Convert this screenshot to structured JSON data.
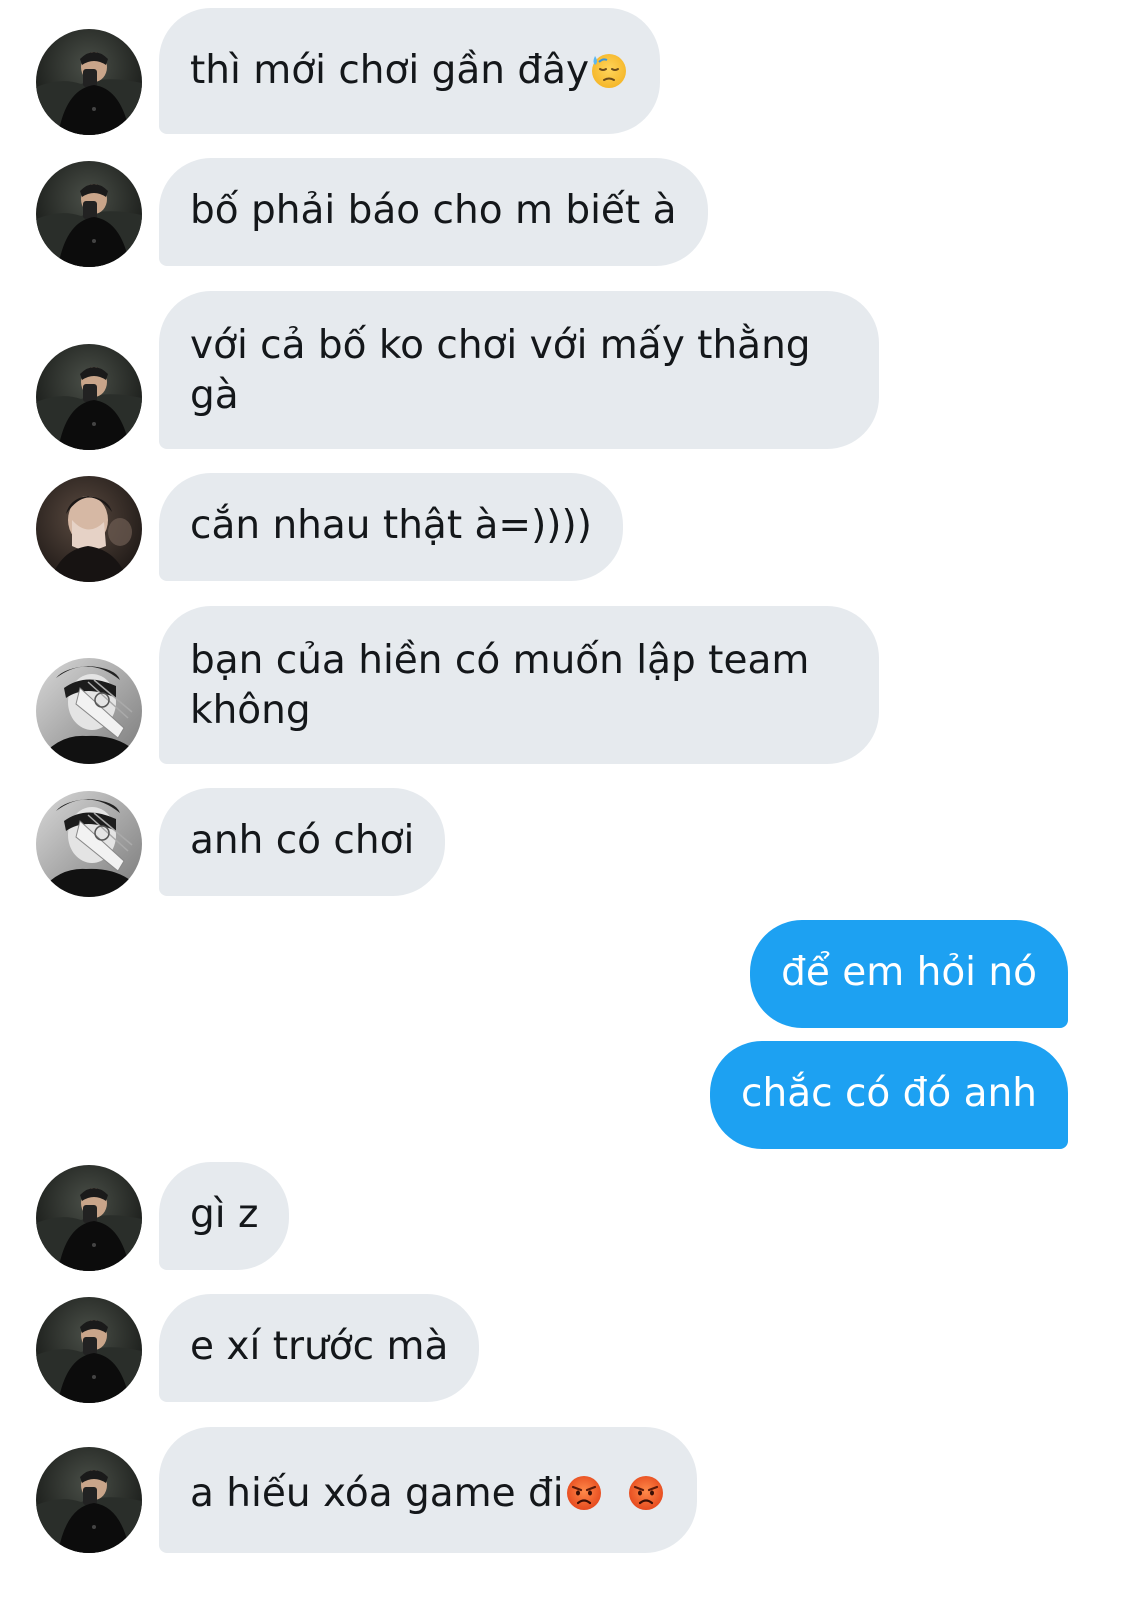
{
  "messages": [
    {
      "dir": "in",
      "avatar": "avatar-a",
      "lines": [
        "thì mới chơi gần đây"
      ],
      "trailing_emoji": [
        "downcast-sweat-emoji"
      ]
    },
    {
      "dir": "in",
      "avatar": "avatar-a",
      "lines": [
        "bố phải báo cho m biết à"
      ]
    },
    {
      "dir": "in",
      "avatar": "avatar-a",
      "lines": [
        "với cả bố ko chơi với mấy thằng",
        "gà"
      ]
    },
    {
      "dir": "in",
      "avatar": "avatar-b",
      "lines": [
        "cắn nhau thật à=))))"
      ]
    },
    {
      "dir": "in",
      "avatar": "avatar-c",
      "lines": [
        "bạn của hiền có muốn lập team",
        "không"
      ]
    },
    {
      "dir": "in",
      "avatar": "avatar-c",
      "lines": [
        "anh có chơi"
      ]
    },
    {
      "dir": "out",
      "lines": [
        "để em hỏi nó"
      ]
    },
    {
      "dir": "out",
      "lines": [
        "chắc có đó anh"
      ]
    },
    {
      "dir": "in",
      "avatar": "avatar-a",
      "lines": [
        "gì z"
      ]
    },
    {
      "dir": "in",
      "avatar": "avatar-a",
      "lines": [
        "e xí trước mà"
      ]
    },
    {
      "dir": "in",
      "avatar": "avatar-a",
      "lines": [
        "a hiếu xóa game đi"
      ],
      "trailing_emoji": [
        "angry-face-emoji",
        "angry-face-emoji"
      ]
    }
  ],
  "colors": {
    "incoming_bubble": "#e6eaee",
    "outgoing_bubble": "#1da1f2",
    "incoming_text": "#14171a",
    "outgoing_text": "#ffffff",
    "background": "#ffffff"
  }
}
